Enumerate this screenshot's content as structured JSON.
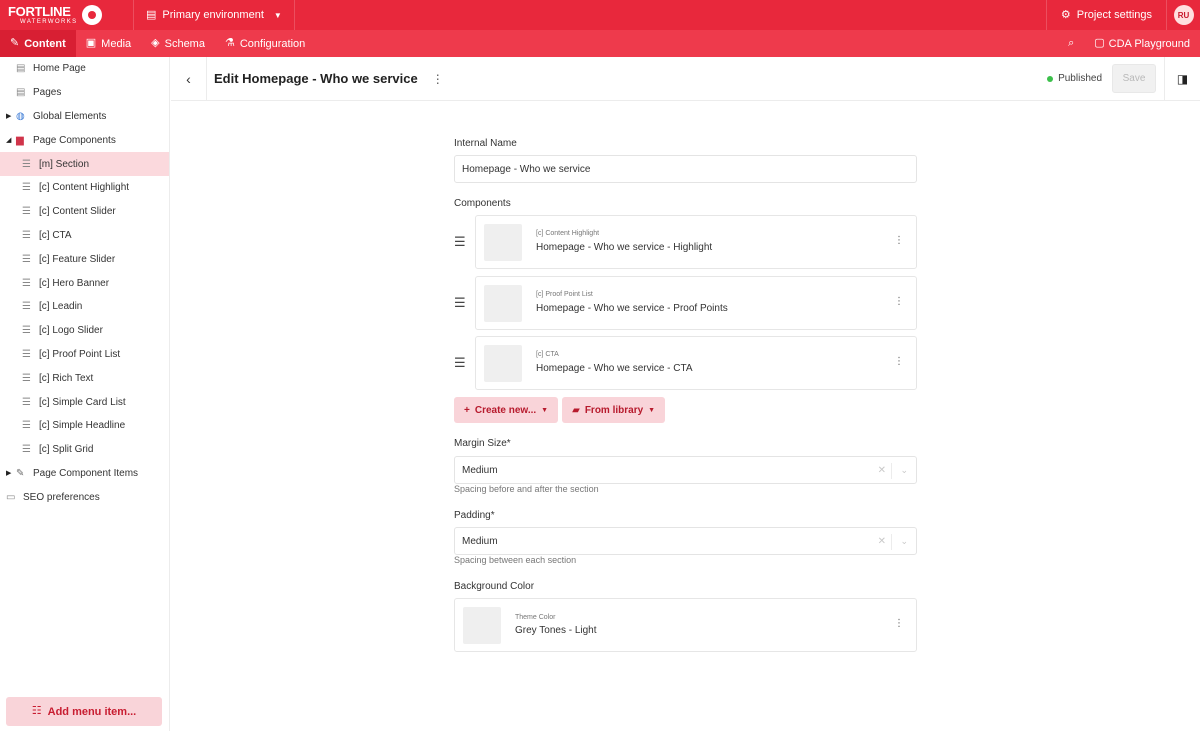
{
  "brand": {
    "logo_main": "FORTLINE",
    "logo_sub": "WATERWORKS",
    "accent": "#e8283c",
    "nav_bg": "#ee3a4c",
    "active_nav": "#d81f33"
  },
  "topbar": {
    "environment": "Primary environment",
    "project_settings": "Project settings",
    "avatar": "RU"
  },
  "nav": {
    "items": [
      {
        "label": "Content",
        "icon": "edit-icon"
      },
      {
        "label": "Media",
        "icon": "image-icon"
      },
      {
        "label": "Schema",
        "icon": "layers-icon"
      },
      {
        "label": "Configuration",
        "icon": "flask-icon"
      }
    ],
    "playground": "CDA Playground"
  },
  "sidebar": {
    "items": [
      {
        "label": "Home Page",
        "icon": "page-icon"
      },
      {
        "label": "Pages",
        "icon": "page-icon"
      },
      {
        "label": "Global Elements",
        "icon": "globe-icon"
      },
      {
        "label": "Page Components",
        "icon": "toolbox-icon"
      },
      {
        "label": "[m] Section",
        "icon": "list-icon"
      },
      {
        "label": "[c] Content Highlight",
        "icon": "list-icon"
      },
      {
        "label": "[c] Content Slider",
        "icon": "list-icon"
      },
      {
        "label": "[c] CTA",
        "icon": "list-icon"
      },
      {
        "label": "[c] Feature Slider",
        "icon": "list-icon"
      },
      {
        "label": "[c] Hero Banner",
        "icon": "list-icon"
      },
      {
        "label": "[c] Leadin",
        "icon": "list-icon"
      },
      {
        "label": "[c] Logo Slider",
        "icon": "list-icon"
      },
      {
        "label": "[c] Proof Point List",
        "icon": "list-icon"
      },
      {
        "label": "[c] Rich Text",
        "icon": "list-icon"
      },
      {
        "label": "[c] Simple Card List",
        "icon": "list-icon"
      },
      {
        "label": "[c] Simple Headline",
        "icon": "list-icon"
      },
      {
        "label": "[c] Split Grid",
        "icon": "list-icon"
      },
      {
        "label": "Page Component Items",
        "icon": "wrench-icon"
      },
      {
        "label": "SEO preferences",
        "icon": "briefcase-icon"
      }
    ],
    "add_menu": "Add menu item..."
  },
  "header": {
    "title": "Edit Homepage - Who we service",
    "status": "Published",
    "save": "Save"
  },
  "form": {
    "internal_name_label": "Internal Name",
    "internal_name_value": "Homepage - Who we service",
    "components_label": "Components",
    "components": [
      {
        "type": "[c] Content Highlight",
        "title": "Homepage - Who we service - Highlight"
      },
      {
        "type": "[c] Proof Point List",
        "title": "Homepage - Who we service - Proof Points"
      },
      {
        "type": "[c] CTA",
        "title": "Homepage - Who we service - CTA"
      }
    ],
    "create_new": "Create new...",
    "from_library": "From library",
    "margin_label": "Margin Size*",
    "margin_value": "Medium",
    "margin_help": "Spacing before and after the section",
    "padding_label": "Padding*",
    "padding_value": "Medium",
    "padding_help": "Spacing between each section",
    "bg_label": "Background Color",
    "bg_type": "Theme Color",
    "bg_value": "Grey Tones - Light"
  }
}
